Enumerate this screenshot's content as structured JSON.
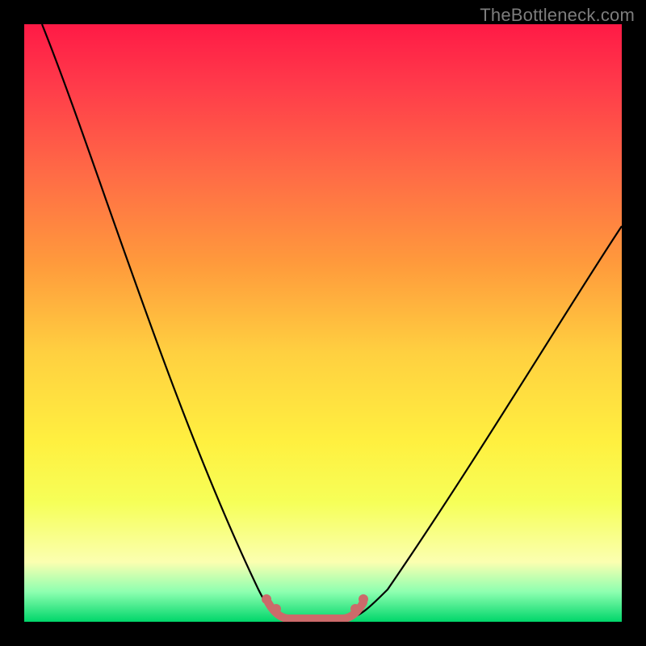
{
  "watermark": "TheBottleneck.com",
  "chart_data": {
    "type": "line",
    "title": "",
    "xlabel": "",
    "ylabel": "",
    "xlim": [
      0,
      1
    ],
    "ylim": [
      0,
      1
    ],
    "series": [
      {
        "name": "bottleneck-curve",
        "x": [
          0.03,
          0.1,
          0.17,
          0.24,
          0.3,
          0.35,
          0.4,
          0.43,
          0.46,
          0.5,
          0.54,
          0.58,
          0.63,
          0.7,
          0.8,
          0.9,
          1.0
        ],
        "values": [
          1.0,
          0.82,
          0.63,
          0.45,
          0.28,
          0.15,
          0.04,
          0.0,
          0.0,
          0.0,
          0.0,
          0.04,
          0.12,
          0.25,
          0.42,
          0.58,
          0.7
        ]
      },
      {
        "name": "flat-highlight",
        "x": [
          0.41,
          0.43,
          0.5,
          0.54,
          0.56
        ],
        "values": [
          0.03,
          0.0,
          0.0,
          0.0,
          0.03
        ]
      }
    ],
    "colors": {
      "bottleneck-curve": "#000000",
      "flat-highlight": "#cc6a6a"
    }
  }
}
